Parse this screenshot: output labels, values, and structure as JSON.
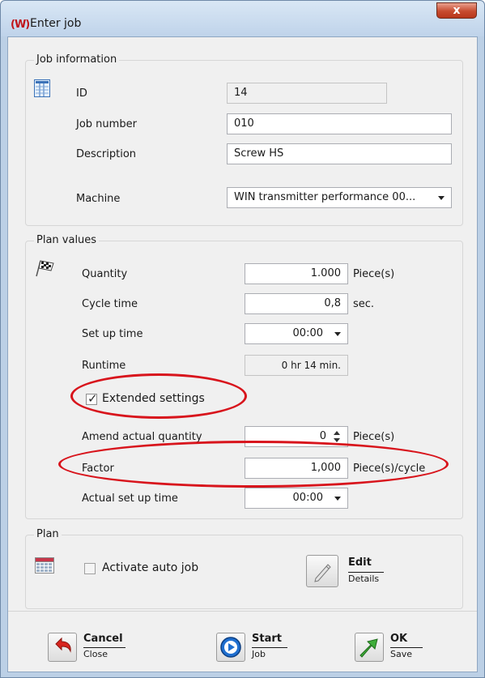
{
  "window": {
    "title": "Enter job",
    "logo_text": "(W)",
    "close_glyph": "x"
  },
  "job_info": {
    "title": "Job information",
    "icon": "document-list-icon",
    "id_label": "ID",
    "id_value": "14",
    "job_number_label": "Job number",
    "job_number_value": "010",
    "description_label": "Description",
    "description_value": "Screw HS",
    "machine_label": "Machine",
    "machine_value": "WIN transmitter performance 00..."
  },
  "plan_values": {
    "title": "Plan values",
    "icon": "checkered-flag-icon",
    "quantity_label": "Quantity",
    "quantity_value": "1.000",
    "quantity_unit": "Piece(s)",
    "cycle_time_label": "Cycle time",
    "cycle_time_value": "0,8",
    "cycle_time_unit": "sec.",
    "setup_time_label": "Set up time",
    "setup_time_value": "00:00",
    "runtime_label": "Runtime",
    "runtime_value": "0 hr 14 min.",
    "extended_label": "Extended settings",
    "extended_checked": true,
    "amend_label": "Amend actual quantity",
    "amend_value": "0",
    "amend_unit": "Piece(s)",
    "factor_label": "Factor",
    "factor_value": "1,000",
    "factor_unit": "Piece(s)/cycle",
    "actual_setup_label": "Actual set up time",
    "actual_setup_value": "00:00"
  },
  "plan": {
    "title": "Plan",
    "icon": "calendar-icon",
    "auto_job_label": "Activate auto job",
    "auto_job_checked": false,
    "edit_main": "Edit",
    "edit_sub": "Details"
  },
  "footer": {
    "cancel_main": "Cancel",
    "cancel_sub": "Close",
    "start_main": "Start",
    "start_sub": "Job",
    "ok_main": "OK",
    "ok_sub": "Save"
  },
  "colors": {
    "annotation": "#d8141c",
    "window_frame": "#bcd0e6",
    "logo_red": "#c0151a"
  }
}
